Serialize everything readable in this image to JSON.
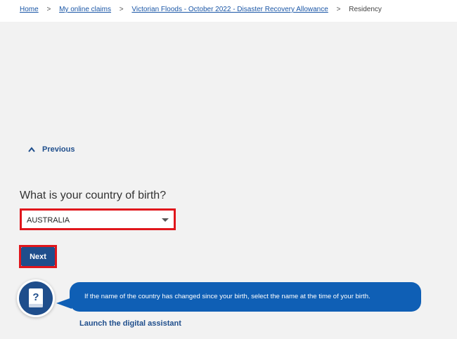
{
  "breadcrumb": {
    "items": [
      "Home",
      "My online claims",
      "Victorian Floods - October 2022 - Disaster Recovery Allowance"
    ],
    "separator": ">",
    "current": "Residency"
  },
  "nav": {
    "previous_label": "Previous"
  },
  "form": {
    "question": "What is your country of birth?",
    "country_select": {
      "value": "AUSTRALIA"
    },
    "next_label": "Next"
  },
  "assistant": {
    "hint": "If the name of the country has changed since your birth, select the name at the time of your birth.",
    "launch_label": "Launch the digital assistant"
  },
  "colors": {
    "primary": "#1f4e8c",
    "bubble": "#0f5fb5",
    "highlight": "#e0161c",
    "background": "#f2f2f2"
  },
  "icons": {
    "previous": "chevron-up-icon",
    "assistant": "help-book-icon",
    "select": "caret-down-icon"
  }
}
